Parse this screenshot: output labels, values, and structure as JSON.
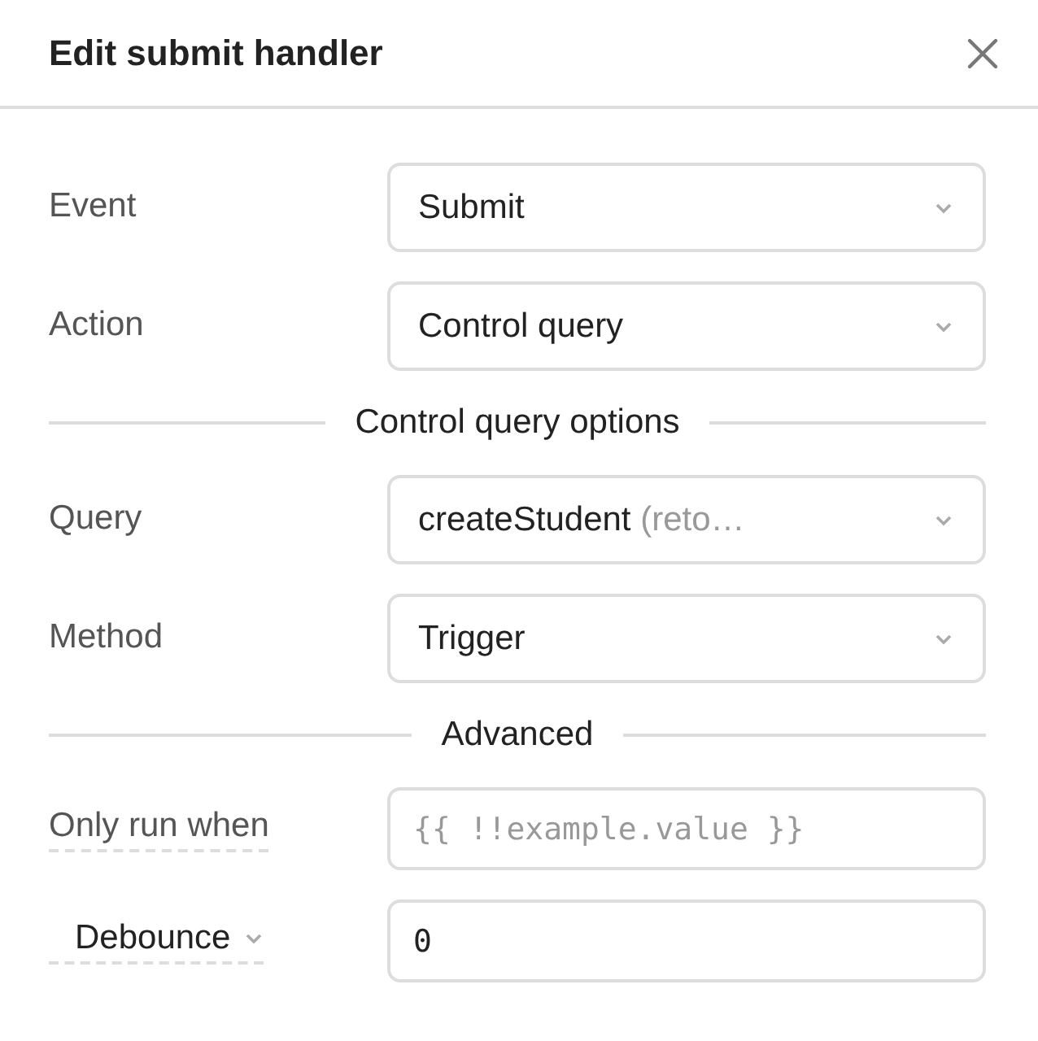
{
  "window": {
    "title": "Edit submit handler"
  },
  "rows": [
    {
      "kind": "select",
      "label": "Event",
      "underlined": false,
      "menu": false,
      "value": "Submit"
    },
    {
      "kind": "select",
      "label": "Action",
      "underlined": false,
      "menu": false,
      "value": "Control query"
    },
    {
      "kind": "divider",
      "label": "Control query options"
    },
    {
      "kind": "select",
      "label": "Query",
      "underlined": false,
      "menu": false,
      "value": "createStudent",
      "detail": "(reto…"
    },
    {
      "kind": "select",
      "label": "Method",
      "underlined": false,
      "menu": false,
      "value": "Trigger"
    },
    {
      "kind": "divider",
      "label": "Advanced"
    },
    {
      "kind": "input",
      "label": "Only run when",
      "underlined": true,
      "menu": false,
      "placeholder": "{{ !!example.value }}"
    },
    {
      "kind": "input",
      "label": "Debounce",
      "underlined": true,
      "menu": true,
      "value": "0"
    }
  ]
}
